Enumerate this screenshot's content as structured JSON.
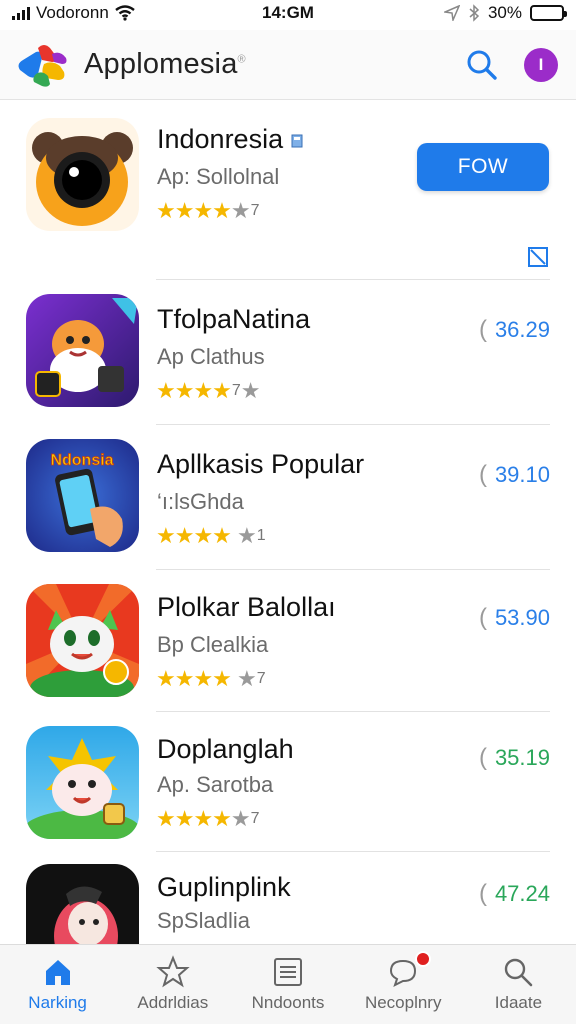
{
  "status_bar": {
    "carrier": "Vodoronn",
    "time": "14:GM",
    "battery": "30%",
    "battery_level": 0.3
  },
  "header": {
    "brand": "Applomesia",
    "brand_mark": "®",
    "avatar_initial": "I"
  },
  "featured": {
    "name": "Indonresia",
    "subtitle": "Ap: Sollolnal",
    "rating_count": "7",
    "stars_full": 4,
    "button_label": "FOW"
  },
  "apps": [
    {
      "name": "TfolpaNatina",
      "subtitle": "Ap Clathus",
      "rating_count": "7",
      "price": "36.29",
      "price_color": "blue"
    },
    {
      "name": "Apllkasis Popular",
      "subtitle": "‘ı:lsGhda",
      "rating_count": "1",
      "price": "39.10",
      "price_color": "blue",
      "icon_text": "Ndonsia"
    },
    {
      "name": "Plolkar Balollaı",
      "subtitle": "Bp Clealkia",
      "rating_count": "7",
      "price": "53.90",
      "price_color": "blue"
    },
    {
      "name": "Doplanglah",
      "subtitle": "Ap. Sarotba",
      "rating_count": "7",
      "price": "35.19",
      "price_color": "green"
    },
    {
      "name": "Guplinplink",
      "subtitle": "SpSladlia",
      "rating_count": "",
      "price": "47.24",
      "price_color": "green"
    }
  ],
  "tabs": [
    {
      "label": "Narking",
      "icon": "home-icon",
      "active": true
    },
    {
      "label": "Addrldias",
      "icon": "star-icon",
      "active": false
    },
    {
      "label": "Nndoonts",
      "icon": "list-icon",
      "active": false
    },
    {
      "label": "Necoplnry",
      "icon": "chat-icon",
      "active": false,
      "badge": true
    },
    {
      "label": "Idaate",
      "icon": "search-icon",
      "active": false
    }
  ],
  "colors": {
    "accent": "#1f7bea",
    "star": "#f5b700",
    "price_green": "#2aa75a",
    "avatar": "#9b2cc9"
  }
}
